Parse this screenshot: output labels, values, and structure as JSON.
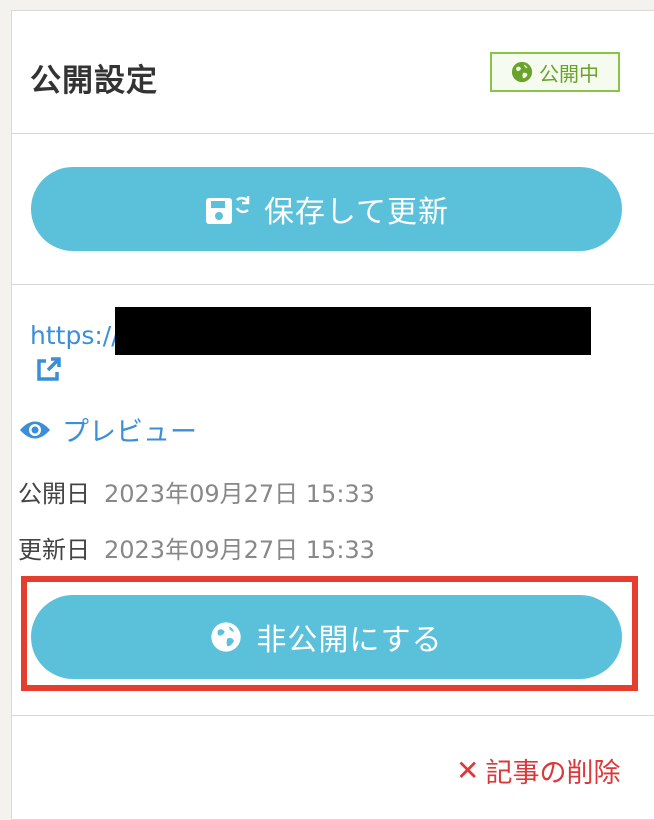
{
  "panel": {
    "title": "公開設定",
    "status_badge": "公開中"
  },
  "actions": {
    "save_update_label": "保存して更新",
    "unpublish_label": "非公開にする",
    "delete_label": "記事の削除"
  },
  "info": {
    "url_text": "https://",
    "preview_label": "プレビュー",
    "published_label": "公開日",
    "published_value": "2023年09月27日 15:33",
    "updated_label": "更新日",
    "updated_value": "2023年09月27日 15:33"
  },
  "colors": {
    "button": "#5bc1db",
    "link": "#3a8fd6",
    "badge_border": "#8ac34a",
    "delete": "#d9393c",
    "highlight": "#e53e2e"
  },
  "icons": [
    "globe-icon",
    "save-refresh-icon",
    "external-link-icon",
    "eye-icon",
    "close-icon"
  ]
}
